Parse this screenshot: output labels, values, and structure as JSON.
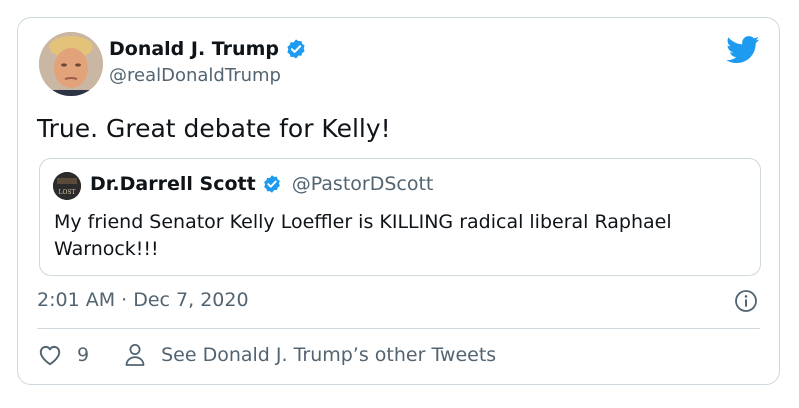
{
  "tweet": {
    "author_name": "Donald J. Trump",
    "author_handle": "@realDonaldTrump",
    "text": "True. Great debate for Kelly!",
    "timestamp": "2:01 AM · Dec 7, 2020",
    "verified": true,
    "icons": {
      "brand": "twitter-bird-icon",
      "verified": "verified-badge-icon",
      "info": "info-icon"
    }
  },
  "quoted_tweet": {
    "author_name": "Dr.Darrell Scott",
    "author_handle": "@PastorDScott",
    "text": "My friend Senator Kelly Loeffler is KILLING radical liberal Raphael Warnock!!!",
    "avatar_lettering": "LOST",
    "verified": true
  },
  "actions": {
    "like_count": "9",
    "other_tweets_label": "See Donald J. Trump’s other Tweets",
    "icons": {
      "like": "heart-icon",
      "profile": "person-icon"
    }
  },
  "colors": {
    "text": "#0f1419",
    "secondary": "#536471",
    "border": "#cfd9de",
    "twitter_blue": "#1d9bf0"
  }
}
